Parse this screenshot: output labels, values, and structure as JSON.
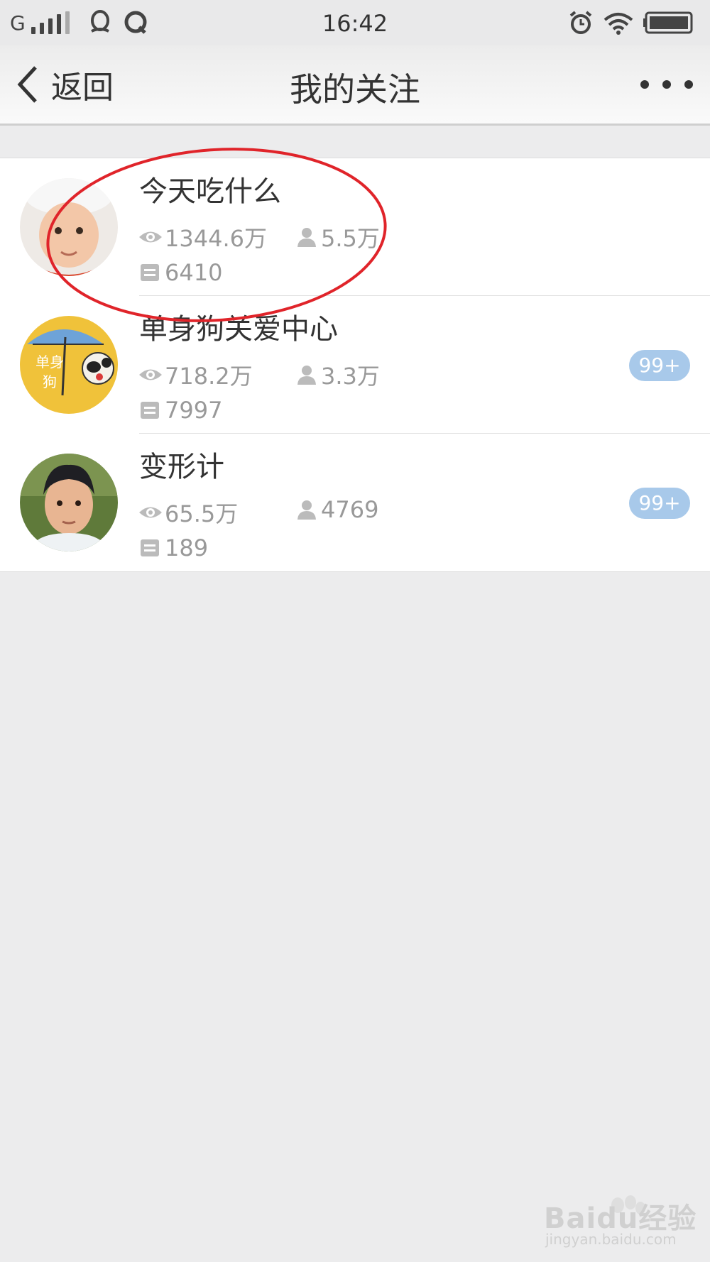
{
  "status_bar": {
    "carrier": "G",
    "time": "16:42"
  },
  "nav": {
    "back_label": "返回",
    "title": "我的关注"
  },
  "follows": [
    {
      "name": "今天吃什么",
      "views": "1344.6万",
      "fans": "5.5万",
      "articles": "6410",
      "badge": ""
    },
    {
      "name": "单身狗关爱中心",
      "views": "718.2万",
      "fans": "3.3万",
      "articles": "7997",
      "badge": "99+"
    },
    {
      "name": "变形计",
      "views": "65.5万",
      "fans": "4769",
      "articles": "189",
      "badge": "99+"
    }
  ],
  "annotation": {
    "color": "#e0242a"
  },
  "watermark": {
    "brand": "Baidu经验",
    "url": "jingyan.baidu.com"
  },
  "colors": {
    "badge": "#a8c9ea",
    "background": "#ececed",
    "stat_text": "#999999"
  }
}
